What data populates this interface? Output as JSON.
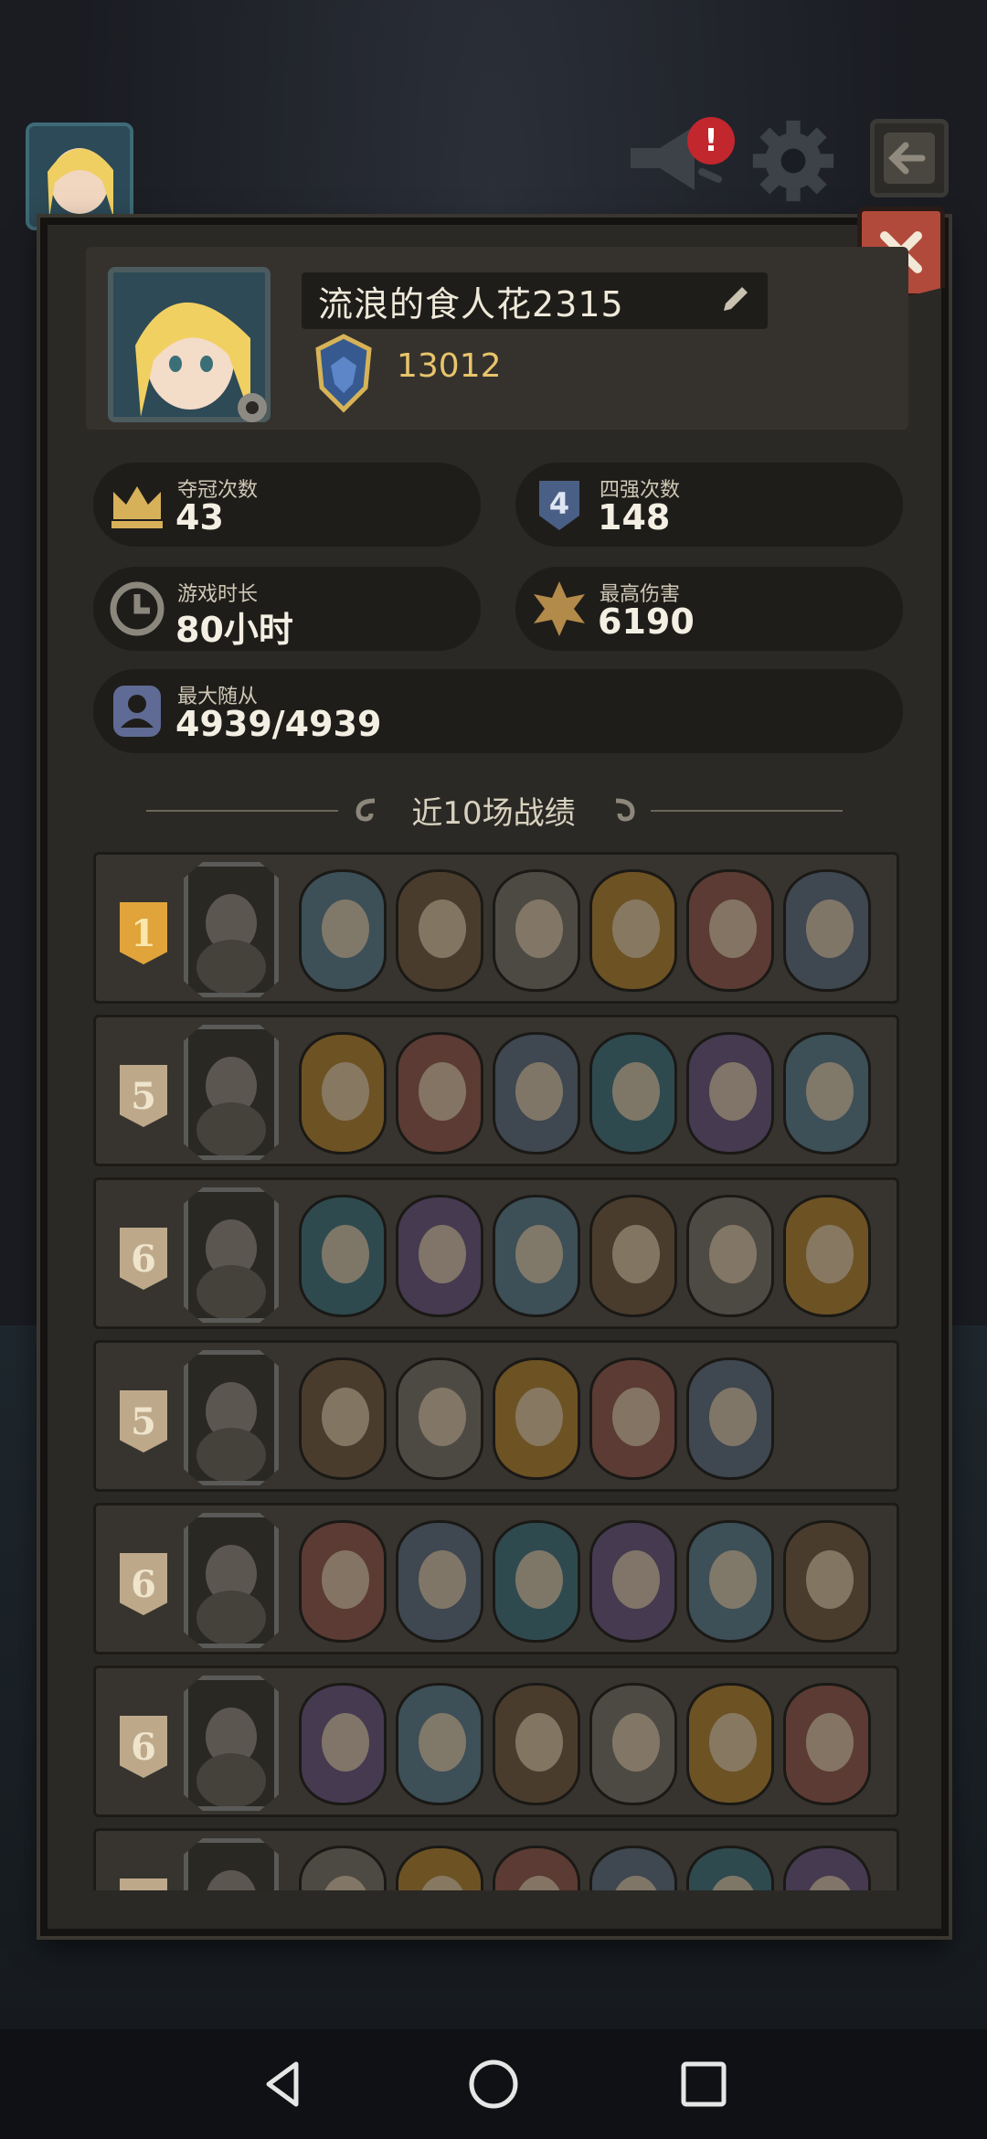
{
  "player": {
    "name": "流浪的食人花2315",
    "rank_score": "13012"
  },
  "stats": [
    {
      "label": "夺冠次数",
      "value": "43",
      "icon": "crown-icon"
    },
    {
      "label": "四强次数",
      "value": "148",
      "icon": "top4-shield-icon"
    },
    {
      "label": "游戏时长",
      "value": "80小时",
      "icon": "clock-icon"
    },
    {
      "label": "最高伤害",
      "value": "6190",
      "icon": "burst-icon"
    },
    {
      "label": "最大随从",
      "value": "4939/4939",
      "icon": "minion-icon"
    }
  ],
  "section_title": "近10场战绩",
  "hud": {
    "notification_badge": "!"
  },
  "matches": [
    {
      "rank": "1",
      "hero": "owl-mask-hero",
      "units": [
        "robot-knight",
        "box-golem",
        "eagle-warrior",
        "flame-rogue",
        "brawler",
        "armored-orc"
      ]
    },
    {
      "rank": "5",
      "hero": "dark-owl-hero",
      "units": [
        "tentacle-chest",
        "shadow-beast",
        "spectral-reaper",
        "red-pirate",
        "bandit",
        "ghost-knight"
      ]
    },
    {
      "rank": "6",
      "hero": "gnome-sage-hero",
      "units": [
        "red-assassin",
        "grey-horse",
        "mushroom-crab",
        "horned-mage",
        "merchant",
        "treant"
      ]
    },
    {
      "rank": "5",
      "hero": "fairy-queen-hero",
      "units": [
        "ogre",
        "plant-beast",
        "raccoon",
        "goblin-grin",
        "night-mushroom"
      ]
    },
    {
      "rank": "6",
      "hero": "clown-hero",
      "units": [
        "eagle-warrior",
        "fallen-dog",
        "grey-horse",
        "frost-gargoyle",
        "ice-beast",
        "purple-bat"
      ]
    },
    {
      "rank": "6",
      "hero": "goblin-lord-hero",
      "units": [
        "fire-demon",
        "fox-bear",
        "shadow-beast",
        "spear-kid",
        "ghost-knight",
        "blue-skeleton"
      ]
    },
    {
      "rank": "",
      "hero": "hooded-hero",
      "units": [
        "red-assassin",
        "horned-mage",
        "treant",
        "armored-orc",
        "bandit",
        "treant"
      ]
    }
  ],
  "colors": {
    "gold": "#e8c46b",
    "panel": "#2b2925",
    "card": "#1f1d1a"
  }
}
